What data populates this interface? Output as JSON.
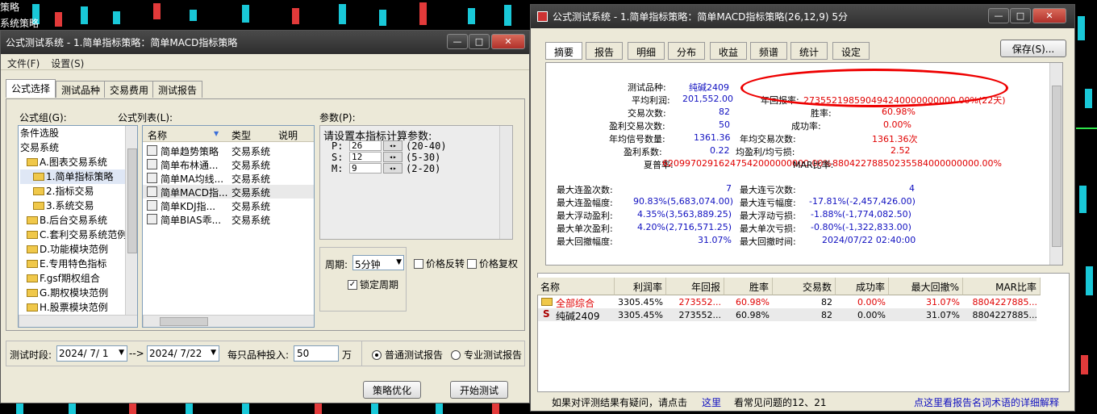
{
  "bg": {
    "label_top": "策略",
    "label_second": "系统策略"
  },
  "left": {
    "title": "公式测试系统 - 1.简单指标策略：简单MACD指标策略",
    "menu": [
      "文件(F)",
      "设置(S)"
    ],
    "tabs": [
      "公式选择",
      "测试品种",
      "交易费用",
      "测试报告"
    ],
    "group_label": "公式组(G):",
    "list_label": "公式列表(L):",
    "param_label": "参数(P):",
    "tree": [
      {
        "label": "条件选股",
        "icon": "none"
      },
      {
        "label": "交易系统",
        "icon": "none"
      },
      {
        "label": "A.图表交易系统",
        "icon": "folder-icon"
      },
      {
        "label": "1.简单指标策略",
        "icon": "folder-open-icon"
      },
      {
        "label": "2.指标交易",
        "icon": "folder-icon"
      },
      {
        "label": "3.系统交易",
        "icon": "folder-icon"
      },
      {
        "label": "B.后台交易系统",
        "icon": "folder-icon"
      },
      {
        "label": "C.套利交易系统范例",
        "icon": "folder-icon"
      },
      {
        "label": "D.功能模块范例",
        "icon": "folder-icon"
      },
      {
        "label": "E.专用特色指标",
        "icon": "folder-icon"
      },
      {
        "label": "F.gsf期权组合",
        "icon": "folder-icon"
      },
      {
        "label": "G.期权模块范例",
        "icon": "folder-icon"
      },
      {
        "label": "H.股票模块范例",
        "icon": "folder-icon"
      }
    ],
    "list_headers": [
      "名称",
      "类型",
      "说明"
    ],
    "list_rows": [
      {
        "name": "简单趋势策略",
        "type": "交易系统"
      },
      {
        "name": "简单布林通...",
        "type": "交易系统"
      },
      {
        "name": "简单MA均线...",
        "type": "交易系统"
      },
      {
        "name": "简单MACD指...",
        "type": "交易系统"
      },
      {
        "name": "简单KDJ指...",
        "type": "交易系统"
      },
      {
        "name": "简单BIAS乖...",
        "type": "交易系统"
      }
    ],
    "param_title": "请设置本指标计算参数:",
    "params": [
      {
        "name": "P:",
        "value": "26",
        "range": "(20-40)"
      },
      {
        "name": "S:",
        "value": "12",
        "range": "(5-30)"
      },
      {
        "name": "M:",
        "value": "9",
        "range": "(2-20)"
      }
    ],
    "period_label": "周期:",
    "period_value": "5分钟",
    "price_reverse": "价格反转",
    "price_restore": "价格复权",
    "lock_period": "锁定周期",
    "test_time_label": "测试时段:",
    "date_from": "2024/ 7/ 1",
    "date_arrow": "-->",
    "date_to": "2024/ 7/22",
    "invest_label": "每只品种投入:",
    "invest_value": "50",
    "invest_unit": "万",
    "radio_normal": "普通测试报告",
    "radio_pro": "专业测试报告",
    "btn_optimize": "策略优化",
    "btn_start": "开始测试"
  },
  "right": {
    "title": "公式测试系统 - 1.简单指标策略：简单MACD指标策略(26,12,9) 5分",
    "tabs": [
      "摘要",
      "报告",
      "明细",
      "分布",
      "收益",
      "频谱",
      "统计",
      "设定"
    ],
    "save": "保存(S)...",
    "summary": {
      "l_variety": "测试品种:",
      "v_variety": "纯碱2409",
      "l_avg_profit": "平均利润:",
      "v_avg_profit": "201,552.00",
      "l_annual": "年回报率:",
      "v_annual": "273552198590494240000000000.00%(22天)",
      "l_trades": "交易次数:",
      "v_trades": "82",
      "l_winrate": "胜率:",
      "v_winrate": "60.98%",
      "l_win_trades": "盈利交易次数:",
      "v_win_trades": "50",
      "l_success": "成功率:",
      "v_success": "0.00%",
      "l_avg_signal": "年均信号数量:",
      "v_avg_signal": "1361.36",
      "l_avg_trades": "年均交易次数:",
      "v_avg_trades": "1361.36次",
      "l_profit_factor": "盈利系数:",
      "v_profit_factor": "0.22",
      "l_avg_ratio": "均盈利/均亏损:",
      "v_avg_ratio": "2.52",
      "l_sharpe": "夏普率:",
      "v_sharpe": "62099702916247542000000000.00%",
      "l_mar": "MAR比率:",
      "v_mar": "88042278850235584000000000.00%",
      "l_max_win_streak": "最大连盈次数:",
      "v_max_win_streak": "7",
      "l_max_loss_streak": "最大连亏次数:",
      "v_max_loss_streak": "4",
      "l_max_win_range": "最大连盈幅度:",
      "v_max_win_range": "90.83%(5,683,074.00)",
      "l_max_loss_range": "最大连亏幅度:",
      "v_max_loss_range": "-17.81%(-2,457,426.00)",
      "l_max_float_win": "最大浮动盈利:",
      "v_max_float_win": "4.35%(3,563,889.25)",
      "l_max_float_loss": "最大浮动亏损:",
      "v_max_float_loss": "-1.88%(-1,774,082.50)",
      "l_max_single_win": "最大单次盈利:",
      "v_max_single_win": "4.20%(2,716,571.25)",
      "l_max_single_loss": "最大单次亏损:",
      "v_max_single_loss": "-0.80%(-1,322,833.00)",
      "l_max_drawdown": "最大回撤幅度:",
      "v_max_drawdown": "31.07%",
      "l_max_dd_time": "最大回撤时间:",
      "v_max_dd_time": "2024/07/22 02:40:00"
    },
    "table_headers": [
      "名称",
      "利润率",
      "年回报",
      "胜率",
      "交易数",
      "成功率",
      "最大回撤%",
      "MAR比率"
    ],
    "rows": [
      {
        "name": "全部综合",
        "profit": "3305.45%",
        "annual": "273552...",
        "win": "60.98%",
        "trades": "82",
        "success": "0.00%",
        "dd": "31.07%",
        "mar": "8804227885..."
      },
      {
        "name": "纯碱2409",
        "profit": "3305.45%",
        "annual": "273552...",
        "win": "60.98%",
        "trades": "82",
        "success": "0.00%",
        "dd": "31.07%",
        "mar": "8804227885..."
      }
    ],
    "footer_q": "如果对评测结果有疑问，请点击",
    "footer_here": "这里",
    "footer_faq": "看常见问题的12、21",
    "footer_link": "点这里看报告名词术语的详细解释"
  }
}
